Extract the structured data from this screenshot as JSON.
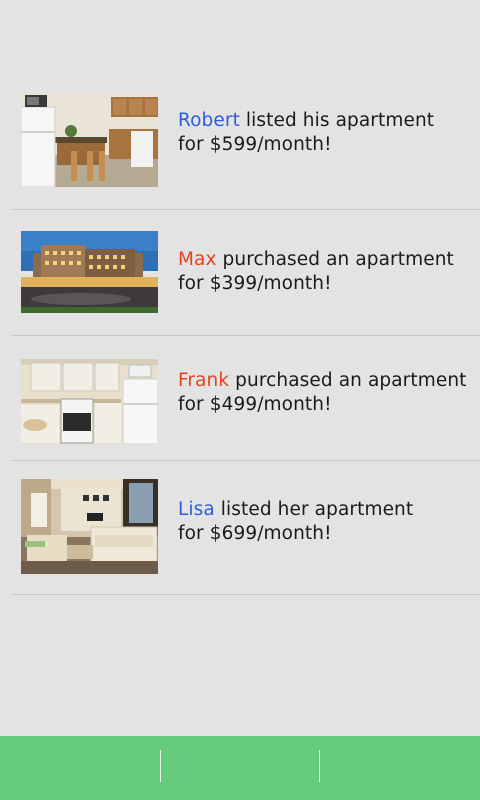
{
  "feed": {
    "items": [
      {
        "name": "Robert",
        "action": " listed his apartment",
        "price": "for $599/month!",
        "name_color": "#2b5fd9",
        "image": "kitchen-photo"
      },
      {
        "name": "Max",
        "action": " purchased an apartment",
        "price": "for $399/month!",
        "name_color": "#e8421c",
        "image": "apartment-building-photo"
      },
      {
        "name": "Frank",
        "action": " purchased an apartment",
        "price": "for $499/month!",
        "name_color": "#e8421c",
        "image": "kitchen-photo"
      },
      {
        "name": "Lisa",
        "action": " listed her apartment",
        "price": "for $699/month!",
        "name_color": "#2b5fd9",
        "image": "living-room-photo"
      }
    ]
  },
  "bottom_bar": {
    "color": "#66cc7c",
    "tabs": [
      "tab-1",
      "tab-2",
      "tab-3"
    ]
  }
}
